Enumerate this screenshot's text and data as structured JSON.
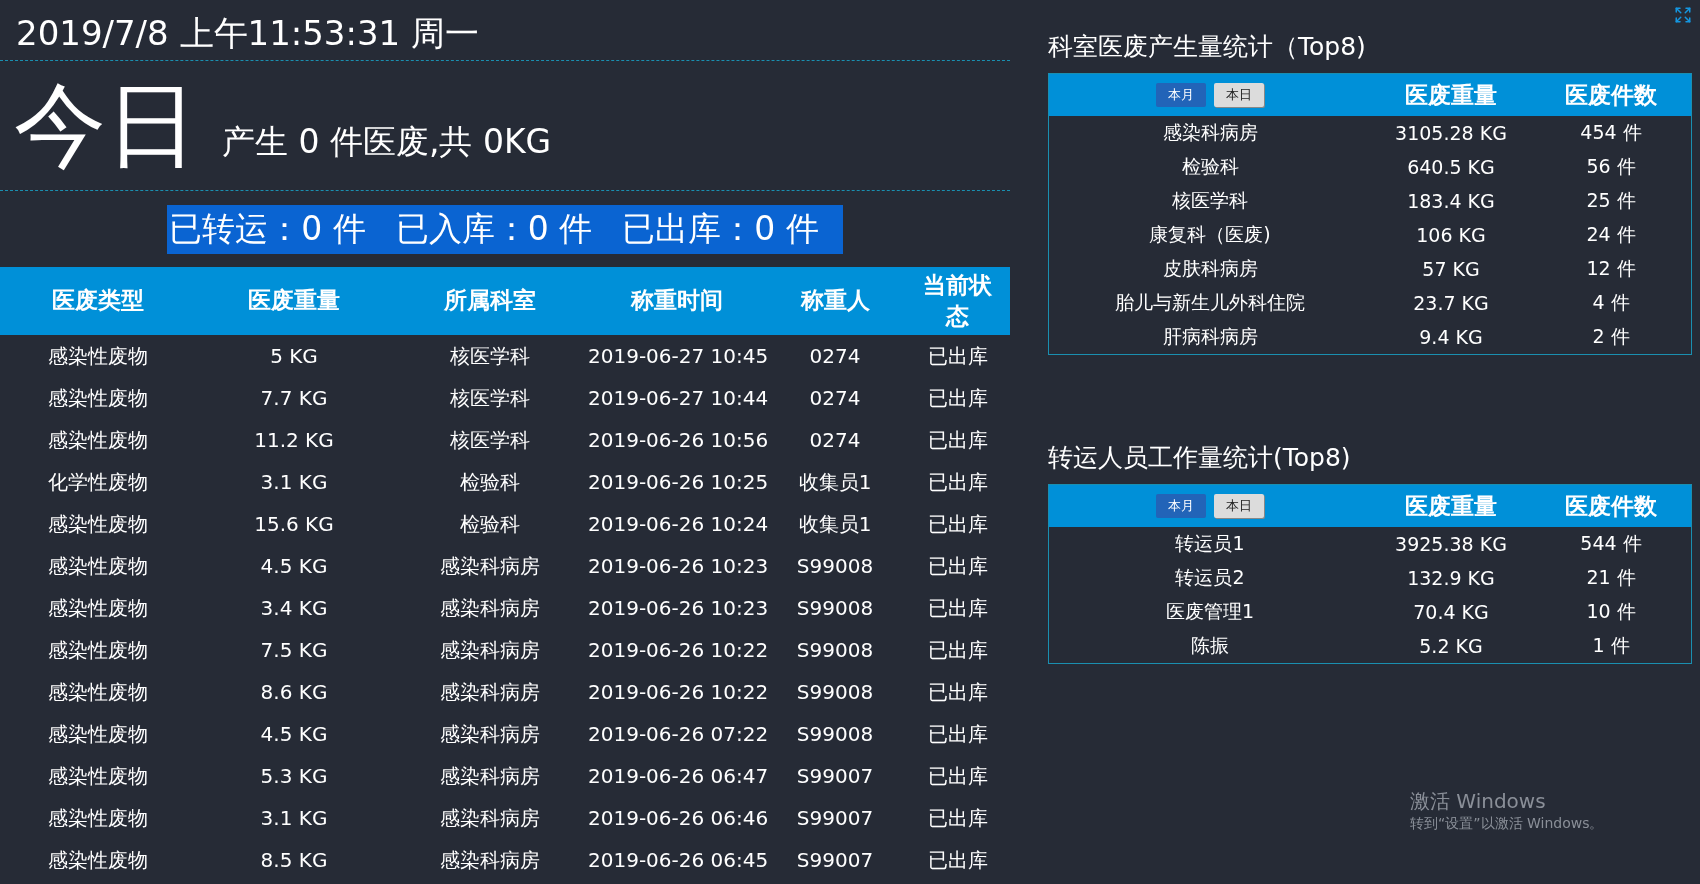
{
  "datetime": "2019/7/8 上午11:53:31 周一",
  "today": {
    "title": "今日",
    "summary": "产生 0 件医废,共 0KG"
  },
  "status_counts": [
    "已转运：0 件",
    "已入库：0 件",
    "已出库：0 件"
  ],
  "waste_table": {
    "columns": [
      "医废类型",
      "医废重量",
      "所属科室",
      "称重时间",
      "称重人",
      "当前状态"
    ],
    "rows": [
      [
        "感染性废物",
        "5 KG",
        "核医学科",
        "2019-06-27 10:45",
        "0274",
        "已出库"
      ],
      [
        "感染性废物",
        "7.7 KG",
        "核医学科",
        "2019-06-27 10:44",
        "0274",
        "已出库"
      ],
      [
        "感染性废物",
        "11.2 KG",
        "核医学科",
        "2019-06-26 10:56",
        "0274",
        "已出库"
      ],
      [
        "化学性废物",
        "3.1 KG",
        "检验科",
        "2019-06-26 10:25",
        "收集员1",
        "已出库"
      ],
      [
        "感染性废物",
        "15.6 KG",
        "检验科",
        "2019-06-26 10:24",
        "收集员1",
        "已出库"
      ],
      [
        "感染性废物",
        "4.5 KG",
        "感染科病房",
        "2019-06-26 10:23",
        "S99008",
        "已出库"
      ],
      [
        "感染性废物",
        "3.4 KG",
        "感染科病房",
        "2019-06-26 10:23",
        "S99008",
        "已出库"
      ],
      [
        "感染性废物",
        "7.5 KG",
        "感染科病房",
        "2019-06-26 10:22",
        "S99008",
        "已出库"
      ],
      [
        "感染性废物",
        "8.6 KG",
        "感染科病房",
        "2019-06-26 10:22",
        "S99008",
        "已出库"
      ],
      [
        "感染性废物",
        "4.5 KG",
        "感染科病房",
        "2019-06-26 07:22",
        "S99008",
        "已出库"
      ],
      [
        "感染性废物",
        "5.3 KG",
        "感染科病房",
        "2019-06-26 06:47",
        "S99007",
        "已出库"
      ],
      [
        "感染性废物",
        "3.1 KG",
        "感染科病房",
        "2019-06-26 06:46",
        "S99007",
        "已出库"
      ],
      [
        "感染性废物",
        "8.5 KG",
        "感染科病房",
        "2019-06-26 06:45",
        "S99007",
        "已出库"
      ]
    ]
  },
  "stat_panels": [
    {
      "title": "科室医废产生量统计（Top8)",
      "toggles": [
        {
          "label": "本月",
          "selected": true
        },
        {
          "label": "本日",
          "selected": false
        }
      ],
      "weight_heading": "医废重量",
      "count_heading": "医废件数",
      "rows": [
        [
          "感染科病房",
          "3105.28 KG",
          "454 件"
        ],
        [
          "检验科",
          "640.5 KG",
          "56 件"
        ],
        [
          "核医学科",
          "183.4 KG",
          "25 件"
        ],
        [
          "康复科（医废)",
          "106 KG",
          "24 件"
        ],
        [
          "皮肤科病房",
          "57 KG",
          "12 件"
        ],
        [
          "胎儿与新生儿外科住院",
          "23.7 KG",
          "4 件"
        ],
        [
          "肝病科病房",
          "9.4 KG",
          "2 件"
        ]
      ]
    },
    {
      "title": "转运人员工作量统计(Top8)",
      "toggles": [
        {
          "label": "本月",
          "selected": true
        },
        {
          "label": "本日",
          "selected": false
        }
      ],
      "weight_heading": "医废重量",
      "count_heading": "医废件数",
      "rows": [
        [
          "转运员1",
          "3925.38 KG",
          "544 件"
        ],
        [
          "转运员2",
          "132.9 KG",
          "21 件"
        ],
        [
          "医废管理1",
          "70.4 KG",
          "10 件"
        ],
        [
          "陈振",
          "5.2 KG",
          "1 件"
        ]
      ]
    }
  ],
  "os_notice": {
    "title": "激活 Windows",
    "text": "转到“设置”以激活 Windows。"
  }
}
